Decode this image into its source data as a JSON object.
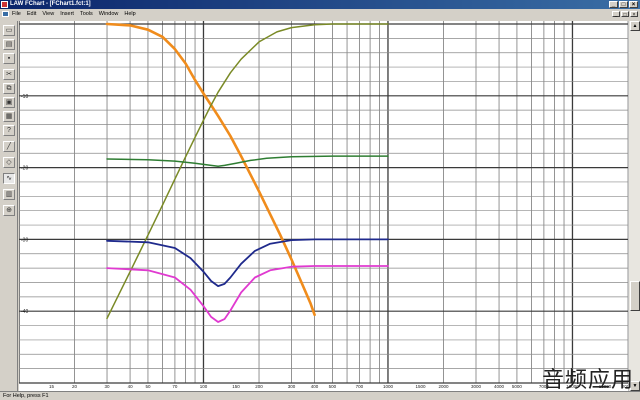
{
  "window": {
    "title": "LAW FChart - [FChart1.fct:1]",
    "controls": [
      "_",
      "□",
      "×"
    ]
  },
  "menubar": {
    "items": [
      "File",
      "Edit",
      "View",
      "Insert",
      "Tools",
      "Window",
      "Help"
    ],
    "controls": [
      "_",
      "□",
      "×"
    ]
  },
  "toolbar": {
    "tools": [
      {
        "icon": "new-icon",
        "glyph": "▭"
      },
      {
        "icon": "open-icon",
        "glyph": "▤"
      },
      {
        "icon": "save-icon",
        "glyph": "▪"
      },
      {
        "icon": "cut-icon",
        "glyph": "✂"
      },
      {
        "icon": "copy-icon",
        "glyph": "⧉"
      },
      {
        "icon": "paste-icon",
        "glyph": "▣"
      },
      {
        "icon": "print-icon",
        "glyph": "▦"
      },
      {
        "icon": "help-icon",
        "glyph": "?"
      },
      {
        "icon": "line-icon",
        "glyph": "╱"
      },
      {
        "icon": "eraser-icon",
        "glyph": "◇"
      },
      {
        "icon": "curve-icon",
        "glyph": "∿"
      },
      {
        "icon": "grid-icon",
        "glyph": "▥"
      },
      {
        "icon": "zoom-icon",
        "glyph": "⊕"
      }
    ]
  },
  "chart_data": {
    "type": "line",
    "x_scale": "log",
    "xlim": [
      10,
      20000
    ],
    "x_ticks": [
      {
        "value": 15,
        "label": "15"
      },
      {
        "value": 20,
        "label": "20"
      },
      {
        "value": 30,
        "label": "30"
      },
      {
        "value": 40,
        "label": "40"
      },
      {
        "value": 50,
        "label": "50"
      },
      {
        "value": 70,
        "label": "70"
      },
      {
        "value": 100,
        "label": "100"
      },
      {
        "value": 150,
        "label": "150"
      },
      {
        "value": 200,
        "label": "200"
      },
      {
        "value": 300,
        "label": "300"
      },
      {
        "value": 400,
        "label": "400"
      },
      {
        "value": 500,
        "label": "500"
      },
      {
        "value": 700,
        "label": "700"
      },
      {
        "value": 1000,
        "label": "1000"
      },
      {
        "value": 1500,
        "label": "1500"
      },
      {
        "value": 2000,
        "label": "2000"
      },
      {
        "value": 3000,
        "label": "3000"
      },
      {
        "value": 4000,
        "label": "4000"
      },
      {
        "value": 5000,
        "label": "5000"
      },
      {
        "value": 7000,
        "label": "7000"
      },
      {
        "value": 10000,
        "label": "10000"
      },
      {
        "value": 15000,
        "label": "15000"
      },
      {
        "value": 20000,
        "label": "20000"
      }
    ],
    "ylim": [
      -50,
      0
    ],
    "y_ticks": [
      {
        "value": -10,
        "label": "-10"
      },
      {
        "value": -20,
        "label": "-20"
      },
      {
        "value": -30,
        "label": "-30"
      },
      {
        "value": -40,
        "label": "-40"
      }
    ],
    "grid": true,
    "series": [
      {
        "color": "#f08c1c",
        "width": 2.6,
        "x": [
          30,
          40,
          50,
          60,
          70,
          80,
          90,
          100,
          110,
          120,
          140,
          160,
          180,
          200,
          230,
          260,
          300,
          340,
          380,
          400
        ],
        "y": [
          0,
          -0.2,
          -0.8,
          -1.8,
          -3.5,
          -5.5,
          -7.8,
          -9.7,
          -11.3,
          -12.8,
          -15.6,
          -18.4,
          -21.0,
          -23.3,
          -26.5,
          -29.3,
          -32.8,
          -36.0,
          -38.9,
          -40.5
        ]
      },
      {
        "color": "#7a8a26",
        "width": 1.5,
        "x": [
          30,
          35,
          40,
          50,
          60,
          70,
          80,
          90,
          100,
          110,
          120,
          140,
          160,
          200,
          250,
          300,
          400,
          500,
          700,
          1000
        ],
        "y": [
          -41,
          -37.5,
          -34.5,
          -29.4,
          -25.2,
          -21.6,
          -18.5,
          -15.8,
          -13.4,
          -11.3,
          -9.5,
          -6.8,
          -4.9,
          -2.5,
          -1.1,
          -0.5,
          -0.1,
          0,
          0,
          0
        ]
      },
      {
        "color": "#2e7d32",
        "width": 1.5,
        "x": [
          30,
          50,
          70,
          90,
          110,
          120,
          130,
          150,
          180,
          220,
          300,
          500,
          1000
        ],
        "y": [
          -18.8,
          -18.9,
          -19.1,
          -19.4,
          -19.7,
          -19.8,
          -19.7,
          -19.4,
          -19.0,
          -18.7,
          -18.5,
          -18.4,
          -18.4
        ]
      },
      {
        "color": "#1f2a8c",
        "width": 1.8,
        "x": [
          30,
          50,
          70,
          85,
          100,
          110,
          120,
          130,
          140,
          160,
          190,
          230,
          300,
          400,
          600,
          1000
        ],
        "y": [
          -30.2,
          -30.4,
          -31.2,
          -32.6,
          -34.5,
          -35.8,
          -36.5,
          -36.2,
          -35.3,
          -33.4,
          -31.6,
          -30.6,
          -30.1,
          -30.0,
          -30.0,
          -30.0
        ]
      },
      {
        "color": "#e03ad0",
        "width": 1.8,
        "x": [
          30,
          50,
          70,
          85,
          100,
          110,
          120,
          130,
          140,
          160,
          190,
          230,
          300,
          400,
          600,
          1000
        ],
        "y": [
          -34.0,
          -34.3,
          -35.3,
          -37.0,
          -39.3,
          -40.8,
          -41.5,
          -41.1,
          -39.9,
          -37.4,
          -35.3,
          -34.3,
          -33.8,
          -33.7,
          -33.7,
          -33.7
        ]
      }
    ]
  },
  "scrollbar": {
    "up": "▲",
    "down": "▼"
  },
  "status": {
    "text": "For Help, press F1"
  },
  "watermark": {
    "text": "音频应用"
  }
}
